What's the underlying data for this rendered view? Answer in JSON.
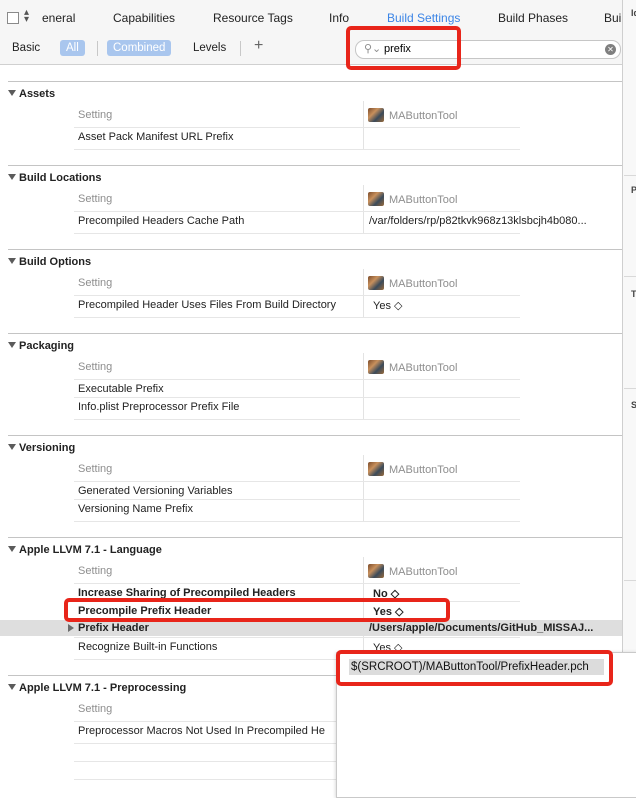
{
  "tabs": [
    {
      "label": "eneral"
    },
    {
      "label": "Capabilities"
    },
    {
      "label": "Resource Tags"
    },
    {
      "label": "Info"
    },
    {
      "label": "Build Settings"
    },
    {
      "label": "Build Phases"
    },
    {
      "label": "Buil"
    }
  ],
  "filter": {
    "basic": "Basic",
    "all": "All",
    "combined": "Combined",
    "levels": "Levels",
    "add": "+",
    "search_value": "prefix"
  },
  "column": {
    "setting": "Setting",
    "target": "MAButtonTool"
  },
  "sections": {
    "assets": {
      "title": "Assets",
      "rows": [
        {
          "label": "Asset Pack Manifest URL Prefix",
          "value": ""
        }
      ]
    },
    "build_locations": {
      "title": "Build Locations",
      "rows": [
        {
          "label": "Precompiled Headers Cache Path",
          "value": "/var/folders/rp/p82tkvk968z13klsbcjh4b080..."
        }
      ]
    },
    "build_options": {
      "title": "Build Options",
      "rows": [
        {
          "label": "Precompiled Header Uses Files From Build Directory",
          "value": "Yes ◇"
        }
      ]
    },
    "packaging": {
      "title": "Packaging",
      "rows": [
        {
          "label": "Executable Prefix",
          "value": ""
        },
        {
          "label": "Info.plist Preprocessor Prefix File",
          "value": ""
        }
      ]
    },
    "versioning": {
      "title": "Versioning",
      "rows": [
        {
          "label": "Generated Versioning Variables",
          "value": ""
        },
        {
          "label": "Versioning Name Prefix",
          "value": ""
        }
      ]
    },
    "llvm_language": {
      "title": "Apple LLVM 7.1 - Language",
      "rows": [
        {
          "label": "Increase Sharing of Precompiled Headers",
          "value": "No ◇"
        },
        {
          "label": "Precompile Prefix Header",
          "value": "Yes ◇"
        },
        {
          "label": "Prefix Header",
          "value": "/Users/apple/Documents/GitHub_MISSAJ..."
        },
        {
          "label": "Recognize Built-in Functions",
          "value": "Yes ◇"
        }
      ]
    },
    "llvm_preprocessing": {
      "title": "Apple LLVM 7.1 - Preprocessing",
      "rows": [
        {
          "label": "Preprocessor Macros Not Used In Precompiled He",
          "value": ""
        }
      ]
    }
  },
  "popover": {
    "value": "$(SRCROOT)/MAButtonTool/PrefixHeader.pch"
  },
  "inspector": {
    "labels": [
      "Id",
      "P",
      "T",
      "S"
    ]
  },
  "colors": {
    "accent": "#3c85e6",
    "highlight": "#e8251a"
  }
}
